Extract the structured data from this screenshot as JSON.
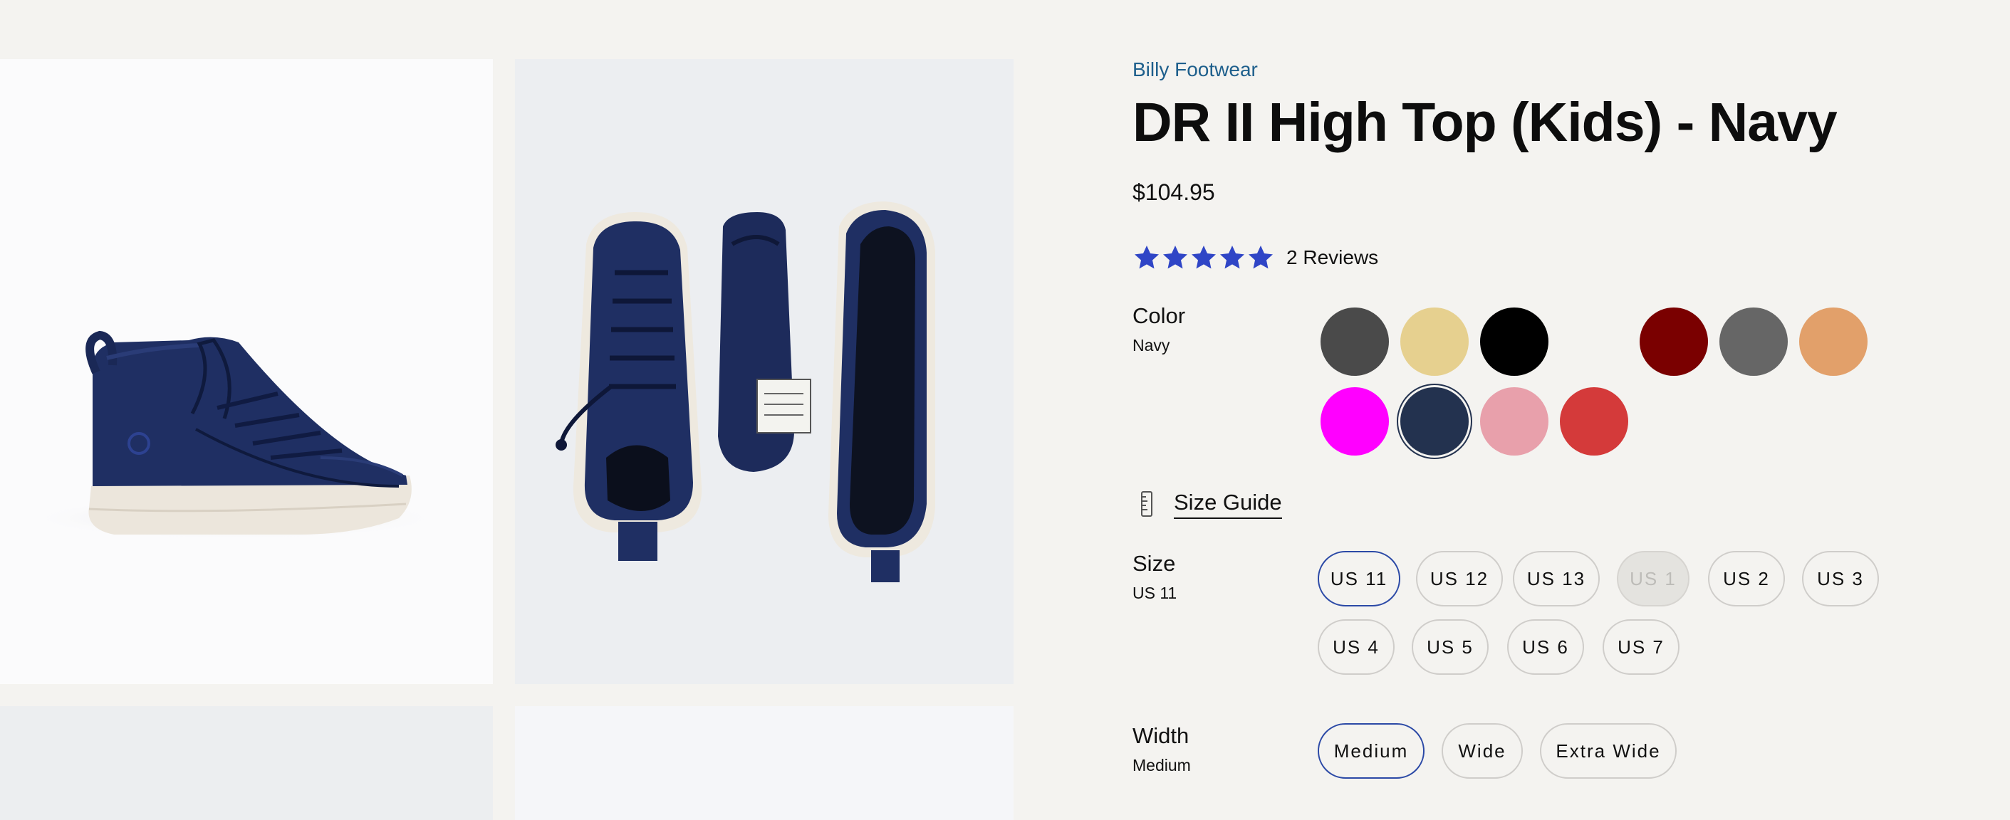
{
  "product": {
    "brand": "Billy Footwear",
    "title": "DR II High Top (Kids) - Navy",
    "price": "$104.95"
  },
  "rating": {
    "stars": 5,
    "star_color": "#2f45c6",
    "reviews_label": "2 Reviews"
  },
  "color_option": {
    "label": "Color",
    "selected_value": "Navy",
    "swatches": [
      {
        "color": "#4a4a4a"
      },
      {
        "color": "#e6d08f"
      },
      {
        "color": "#000000"
      },
      {
        "color": "#f4f3f0"
      },
      {
        "color": "#7a0000"
      },
      {
        "color": "#666666"
      },
      {
        "color": "#e2a06a"
      },
      {
        "color": "#ff00ff"
      },
      {
        "color": "#23324f",
        "selected": true
      },
      {
        "color": "#e8a0ab"
      },
      {
        "color": "#d43a3a"
      }
    ]
  },
  "size_guide": {
    "label": "Size Guide",
    "icon": "ruler-icon"
  },
  "size_option": {
    "label": "Size",
    "selected_value": "US 11",
    "options": [
      {
        "label": "US 11",
        "state": "selected"
      },
      {
        "label": "US 12",
        "state": "available"
      },
      {
        "label": "US 13",
        "state": "available"
      },
      {
        "label": "US 1",
        "state": "disabled"
      },
      {
        "label": "US 2",
        "state": "available"
      },
      {
        "label": "US 3",
        "state": "available"
      },
      {
        "label": "US 4",
        "state": "available"
      },
      {
        "label": "US 5",
        "state": "available"
      },
      {
        "label": "US 6",
        "state": "available"
      },
      {
        "label": "US 7",
        "state": "available"
      }
    ]
  },
  "width_option": {
    "label": "Width",
    "selected_value": "Medium",
    "options": [
      {
        "label": "Medium",
        "state": "selected"
      },
      {
        "label": "Wide",
        "state": "available"
      },
      {
        "label": "Extra Wide",
        "state": "available"
      }
    ]
  },
  "colors": {
    "brand_link": "#1e5f8c",
    "selected_pill_border": "#2b49a6",
    "shoe_navy": "#1f2f63",
    "sole": "#ece6dc"
  }
}
